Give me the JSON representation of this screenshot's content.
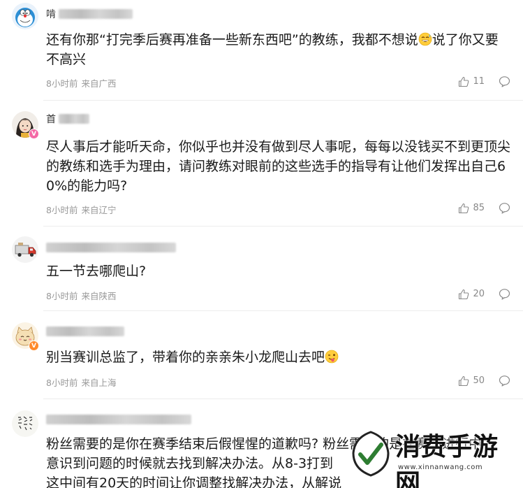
{
  "comments": [
    {
      "name_prefix": "啃",
      "content": "还有你那“打完季后赛再准备一些新东西吧”的教练，我都不想说",
      "content_tail": "说了你又要不高兴",
      "emoji": "sweat-smile",
      "time": "8小时前",
      "location": "来自广西",
      "likes": "11",
      "badge": ""
    },
    {
      "name_prefix": "首",
      "content": "尽人事后才能听天命，你似乎也并没有做到尽人事呢，每每以没钱买不到更顶尖的教练和选手为理由，请问教练对眼前的这些选手的指导有让他们发挥出自己60%的能力吗?",
      "time": "8小时前",
      "location": "来自辽宁",
      "likes": "85",
      "badge": "V"
    },
    {
      "name_prefix": "",
      "content": "五一节去哪爬山?",
      "time": "8小时前",
      "location": "来自陕西",
      "likes": "20",
      "badge": ""
    },
    {
      "name_prefix": "",
      "content": "别当赛训总监了，带着你的亲亲朱小龙爬山去吧",
      "emoji": "tongue-wink",
      "time": "8小时前",
      "location": "来自上海",
      "likes": "50",
      "badge": "V"
    },
    {
      "name_prefix": "",
      "content": "粉丝需要的是你在赛季结束后假惺惺的道歉吗? 粉丝需要的是在赛季进行中意识到问题的时候就去找到解决办法。从8-3打到接近... 这中间有20天的时间让你调整找解决办法，从解说",
      "line1": "粉丝需要的是你在赛季结束后假惺惺的道歉吗? 粉丝需要的是在赛季进行中",
      "line2": "意识到问题的时候就去找到解决办法。从8-3打到",
      "line3": "这中间有20天的时间让你调整找解决办法，从解说"
    }
  ],
  "watermark": {
    "title": "消费手游网",
    "url": "www.xinnanwang.com"
  },
  "colors": {
    "meta": "#999999",
    "badge_orange": "#ff8a2b",
    "badge_pink": "#f46aa6",
    "logo_green": "#2e7d32"
  }
}
